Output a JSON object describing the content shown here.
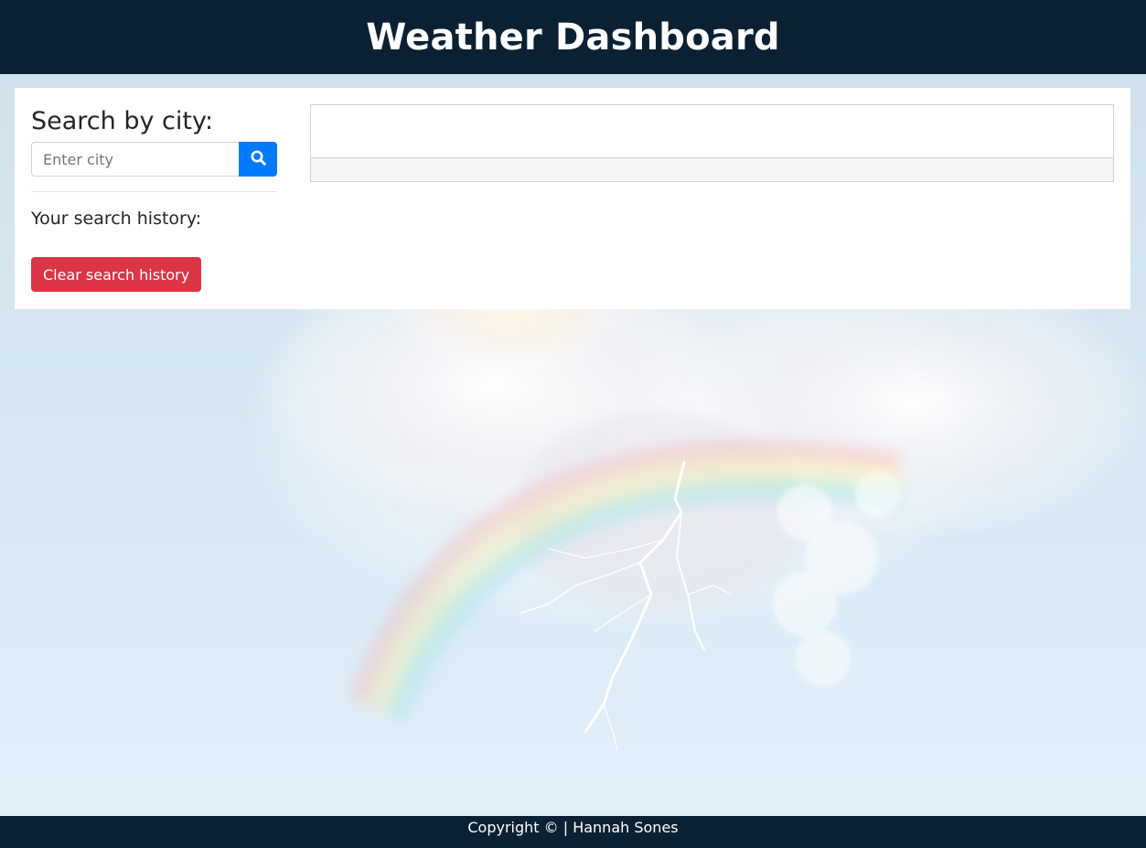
{
  "header": {
    "title": "Weather Dashboard"
  },
  "search": {
    "title": "Search by city:",
    "placeholder": "Enter city",
    "value": "",
    "button_icon": "search-icon"
  },
  "history": {
    "title": "Your search history:",
    "items": [],
    "clear_label": "Clear search history"
  },
  "footer": {
    "copyright": "Copyright © | Hannah Sones"
  },
  "background": {
    "image": "sky-rainbow-lightning-image"
  },
  "colors": {
    "header_bg": "#0b2133",
    "search_button": "#007bff",
    "clear_button": "#dc3545"
  }
}
